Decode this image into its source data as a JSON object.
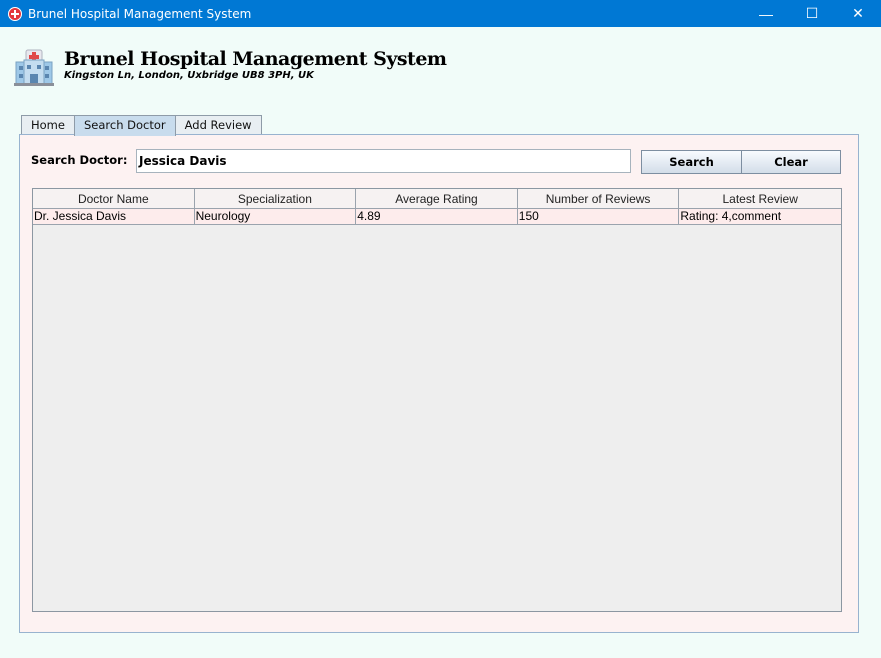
{
  "window": {
    "title": "Brunel Hospital Management System",
    "controls": {
      "minimize": "—",
      "maximize": "☐",
      "close": "✕"
    }
  },
  "header": {
    "title": "Brunel Hospital Management System",
    "address": "Kingston Ln, London, Uxbridge UB8 3PH, UK",
    "icon": "hospital-building-icon"
  },
  "tabs": [
    {
      "label": "Home",
      "active": false
    },
    {
      "label": "Search Doctor",
      "active": true
    },
    {
      "label": "Add Review",
      "active": false
    }
  ],
  "search": {
    "label": "Search Doctor:",
    "value": "Jessica Davis",
    "search_button": "Search",
    "clear_button": "Clear"
  },
  "table": {
    "columns": [
      "Doctor Name",
      "Specialization",
      "Average Rating",
      "Number of Reviews",
      "Latest Review"
    ],
    "rows": [
      [
        "Dr. Jessica Davis",
        "Neurology",
        "4.89",
        "150",
        "Rating: 4,comment"
      ]
    ]
  },
  "colors": {
    "titlebar": "#0078d4",
    "background": "#f1fcf9",
    "panel": "#fdf2f2",
    "table_body": "#eeeeee"
  }
}
